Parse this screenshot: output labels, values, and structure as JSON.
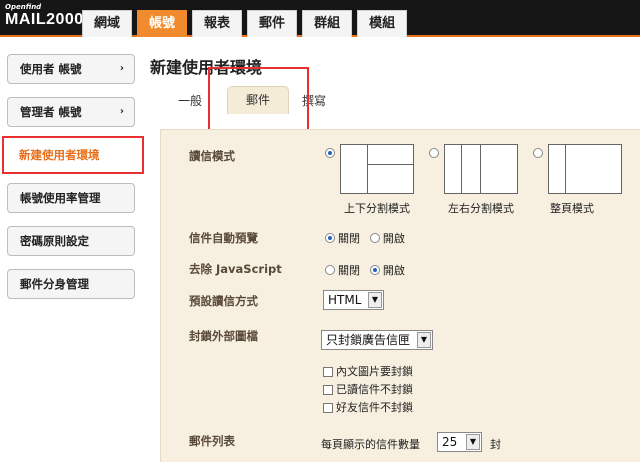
{
  "logo": {
    "small": "Openfind",
    "big": "MAIL2000"
  },
  "nav_tabs": [
    "網域",
    "帳號",
    "報表",
    "郵件",
    "群組",
    "模組"
  ],
  "sidebar": {
    "items": [
      {
        "label": "使用者 帳號",
        "chevron": "›"
      },
      {
        "label": "管理者 帳號",
        "chevron": "›"
      },
      {
        "label": "新建使用者環境"
      },
      {
        "label": "帳號使用率管理"
      },
      {
        "label": "密碼原則設定"
      },
      {
        "label": "郵件分身管理"
      }
    ],
    "active_index": 2
  },
  "page_title": "新建使用者環境",
  "sub_tabs": [
    "一般",
    "郵件",
    "撰寫"
  ],
  "active_sub_tab": 1,
  "settings": {
    "read_mode": {
      "label": "讀信模式",
      "options": [
        "上下分割模式",
        "左右分割模式",
        "整頁模式"
      ],
      "selected_index": 0
    },
    "auto_preview": {
      "label": "信件自動預覽",
      "options": [
        "關閉",
        "開啟"
      ],
      "selected_index": 0
    },
    "remove_js": {
      "label": "去除 JavaScript",
      "options": [
        "關閉",
        "開啟"
      ],
      "selected_index": 1
    },
    "default_read": {
      "label": "預設讀信方式",
      "value": "HTML"
    },
    "block_external": {
      "label": "封鎖外部圖檔",
      "value": "只封鎖廣告信匣",
      "checkboxes": [
        "內文圖片要封鎖",
        "已讀信件不封鎖",
        "好友信件不封鎖"
      ]
    },
    "mail_list": {
      "label": "郵件列表",
      "prefix": "每頁顯示的信件數量",
      "value": "25",
      "suffix": "封"
    }
  },
  "colors": {
    "accent": "#f08a2d",
    "highlight": "#e83030",
    "panel": "#f7f0e0"
  }
}
